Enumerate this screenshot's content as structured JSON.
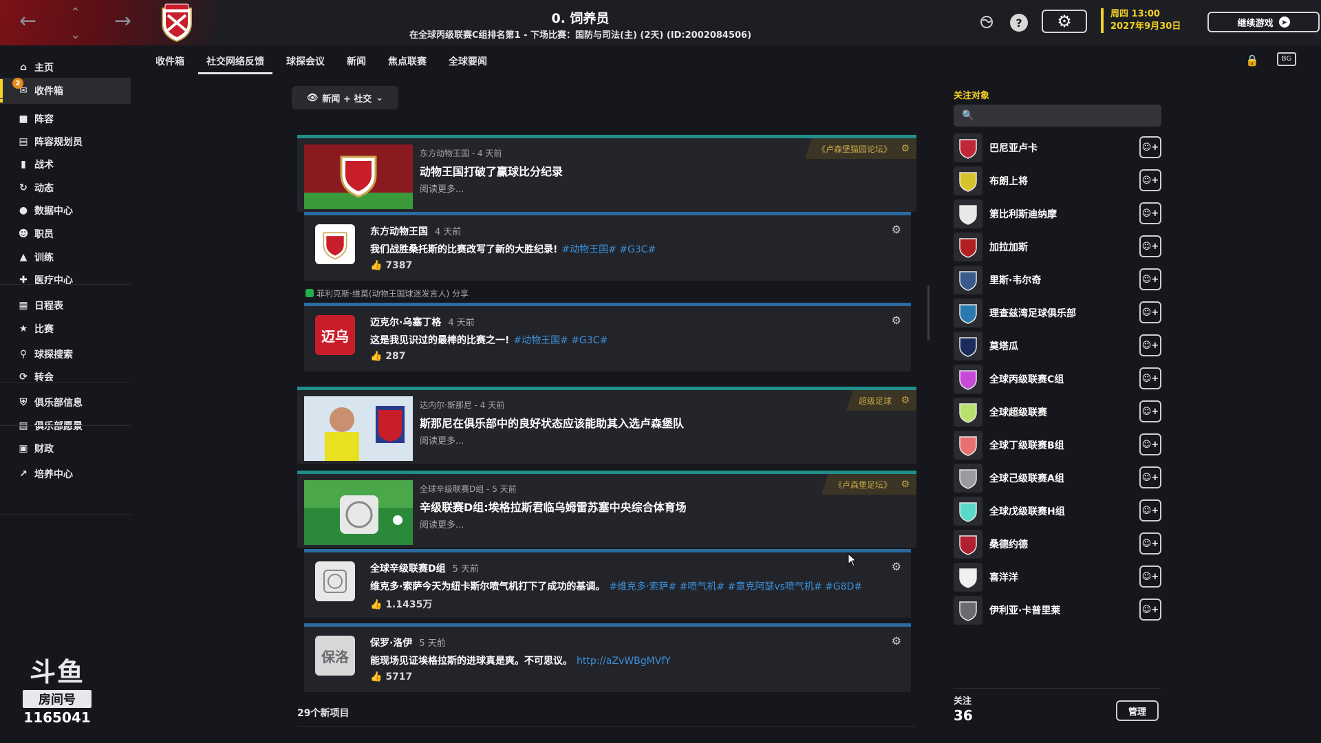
{
  "header": {
    "title": "0. 饲养员",
    "subtitle": "在全球丙级联赛C组排名第1 - 下场比赛：国防与司法(主) (2天) (ID:2002084506)",
    "date_line1": "周四 13:00",
    "date_line2": "2027年9月30日",
    "continue_label": "继续游戏"
  },
  "sidebar": {
    "items": [
      {
        "label": "主页",
        "icon": "home-icon"
      },
      {
        "label": "收件箱",
        "icon": "inbox-icon",
        "badge": "2"
      },
      {
        "label": "阵容",
        "icon": "shirt-icon"
      },
      {
        "label": "阵容规划员",
        "icon": "clipboard-icon"
      },
      {
        "label": "战术",
        "icon": "tactics-icon"
      },
      {
        "label": "动态",
        "icon": "dynamics-icon"
      },
      {
        "label": "数据中心",
        "icon": "data-icon"
      },
      {
        "label": "职员",
        "icon": "staff-icon"
      },
      {
        "label": "训练",
        "icon": "training-icon"
      },
      {
        "label": "医疗中心",
        "icon": "medical-icon"
      },
      {
        "label": "日程表",
        "icon": "calendar-icon"
      },
      {
        "label": "比赛",
        "icon": "trophy-icon"
      },
      {
        "label": "球探搜索",
        "icon": "scout-search-icon"
      },
      {
        "label": "转会",
        "icon": "transfer-icon"
      },
      {
        "label": "俱乐部信息",
        "icon": "club-info-icon"
      },
      {
        "label": "俱乐部愿景",
        "icon": "club-vision-icon"
      },
      {
        "label": "财政",
        "icon": "finance-icon"
      },
      {
        "label": "培养中心",
        "icon": "development-icon"
      }
    ],
    "watermark_logo": "斗鱼",
    "watermark_room": "房间号",
    "watermark_number": "1165041"
  },
  "tabs": [
    {
      "label": "收件箱",
      "active": false
    },
    {
      "label": "社交网络反馈",
      "active": true
    },
    {
      "label": "球探会议",
      "active": false
    },
    {
      "label": "新闻",
      "active": false
    },
    {
      "label": "焦点联赛",
      "active": false
    },
    {
      "label": "全球要闻",
      "active": false
    }
  ],
  "filter": {
    "label": "新闻 + 社交"
  },
  "feed": {
    "news": [
      {
        "meta": "东方动物王国 - 4 天前",
        "headline": "动物王国打破了赢球比分纪录",
        "more": "阅读更多...",
        "tag": "《卢森堡猫园论坛》"
      },
      {
        "meta": "达内尔·斯那尼 - 4 天前",
        "headline": "斯那尼在俱乐部中的良好状态应该能助其入选卢森堡队",
        "more": "阅读更多...",
        "tag": "超级足球"
      },
      {
        "meta": "全球辛级联赛D组 - 5 天前",
        "headline": "辛级联赛D组:埃格拉斯君临乌姆雷苏塞中央综合体育场",
        "more": "阅读更多...",
        "tag": "《卢森堡足坛》"
      }
    ],
    "posts": [
      {
        "name": "东方动物王国",
        "when": "4 天前",
        "text": "我们战胜桑托斯的比赛改写了新的大胜纪录!",
        "hashtags": "#动物王国# #G3C#",
        "likes": "7387",
        "avatar_text": ""
      },
      {
        "name": "迈克尔·乌塞丁格",
        "when": "4 天前",
        "text": "这是我见识过的最棒的比赛之一!",
        "hashtags": "#动物王国# #G3C#",
        "likes": "287",
        "avatar_text": "迈乌"
      },
      {
        "name": "全球辛级联赛D组",
        "when": "5 天前",
        "text": "维克多·索萨今天为纽卡斯尔喷气机打下了成功的基调。",
        "hashtags": "#维克多·索萨# #喷气机# #意克阿瑟vs喷气机# #G8D#",
        "likes": "1.1435万",
        "avatar_text": ""
      },
      {
        "name": "保罗·洛伊",
        "when": "5 天前",
        "text": "能现场见证埃格拉斯的进球真是爽。不可思议。",
        "hashtags": "http://aZvWBgMVfY",
        "likes": "5717",
        "avatar_text": "保洛"
      }
    ],
    "share_note": "菲利克斯·维莫(动物王国球迷发言人) 分享",
    "new_count": "29个新项目"
  },
  "follow_panel": {
    "title": "关注对象",
    "search_placeholder": "",
    "items": [
      {
        "name": "巴尼亚卢卡",
        "color": "#c0283a"
      },
      {
        "name": "布朗上将",
        "color": "#d8c22a"
      },
      {
        "name": "第比利斯迪纳摩",
        "color": "#e8e8e8"
      },
      {
        "name": "加拉加斯",
        "color": "#b02020"
      },
      {
        "name": "里斯·韦尔奇",
        "color": "#3a5a8a"
      },
      {
        "name": "理查兹湾足球俱乐部",
        "color": "#2a7ab0"
      },
      {
        "name": "莫塔瓜",
        "color": "#1a2a5a"
      },
      {
        "name": "全球丙级联赛C组",
        "color": "#c84ad8"
      },
      {
        "name": "全球超级联赛",
        "color": "#b8e06a"
      },
      {
        "name": "全球丁级联赛B组",
        "color": "#e87070"
      },
      {
        "name": "全球己级联赛A组",
        "color": "#9a9aa0"
      },
      {
        "name": "全球戊级联赛H组",
        "color": "#5ad8c8"
      },
      {
        "name": "桑德约德",
        "color": "#b02030"
      },
      {
        "name": "喜洋洋",
        "color": "#f0f0f0"
      },
      {
        "name": "伊利亚·卡普里莱",
        "color": "#6a6a70"
      }
    ],
    "follow_label": "关注",
    "follow_count": "36",
    "manage_label": "管理"
  }
}
